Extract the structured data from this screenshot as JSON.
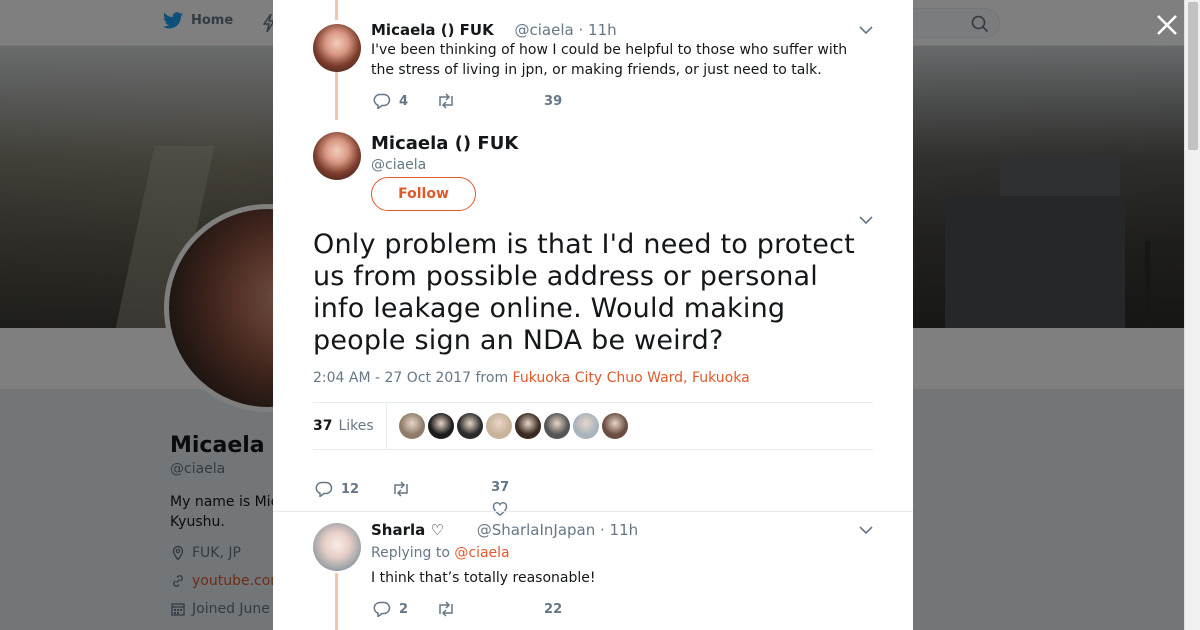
{
  "nav": {
    "home_label": "Home"
  },
  "profile": {
    "name": "Micaela (",
    "handle": "@ciaela",
    "bio": "My name is Mic Kyushu.",
    "location": "FUK, JP",
    "website": "youtube.com",
    "joined": "Joined June"
  },
  "tweets": {
    "prev": {
      "name": "Micaela () FUK",
      "handle": "@ciaela",
      "time": "11h",
      "text": "I've been thinking of how I could be helpful to those who suffer with the stress of living in jpn, or making friends, or just need to talk.",
      "replies": "4",
      "likes": "39"
    },
    "main": {
      "name": "Micaela () FUK",
      "handle": "@ciaela",
      "follow_label": "Follow",
      "text": "Only problem is that I'd need to protect us from possible address or personal info leakage online. Would making people sign an NDA be weird?",
      "timestamp": "2:04 AM - 27 Oct 2017 from",
      "location": "Fukuoka City Chuo Ward, Fukuoka",
      "likes_count": "37",
      "likes_label": "Likes",
      "replies": "12",
      "likes": "37",
      "liker_colors": [
        "#8f7d6b",
        "#1c1c1c",
        "#2b2b2b",
        "#c8b29a",
        "#3a2a22",
        "#555555",
        "#aab4bc",
        "#6b4e42"
      ]
    },
    "reply": {
      "name": "Sharla ♡",
      "handle": "@SharlaInJapan",
      "time": "11h",
      "replying_prefix": "Replying to",
      "replying_to": "@ciaela",
      "text": "I think that’s totally reasonable!",
      "replies": "2",
      "likes": "22"
    }
  },
  "colors": {
    "accent": "#e0592a",
    "twitter_blue": "#1da1f2",
    "thread_line": "#f5c3ad"
  }
}
